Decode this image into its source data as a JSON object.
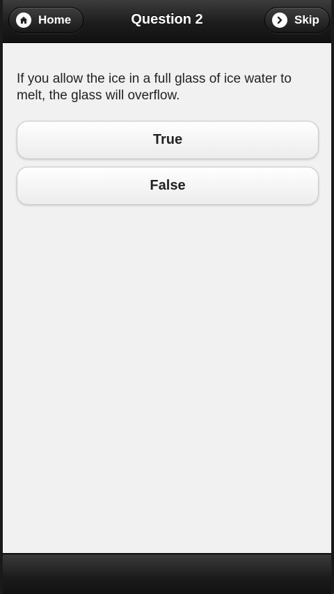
{
  "header": {
    "title": "Question 2",
    "home_label": "Home",
    "skip_label": "Skip",
    "home_icon": "home-icon",
    "skip_icon": "chevron-right-icon"
  },
  "question": {
    "text": "If you allow the ice in a full glass of ice water to melt, the glass will overflow."
  },
  "answers": [
    {
      "label": "True"
    },
    {
      "label": "False"
    }
  ],
  "colors": {
    "header_bg": "#1c1c1c",
    "content_bg": "#f1f1f1",
    "button_bg": "#ffffff",
    "text": "#222222"
  }
}
